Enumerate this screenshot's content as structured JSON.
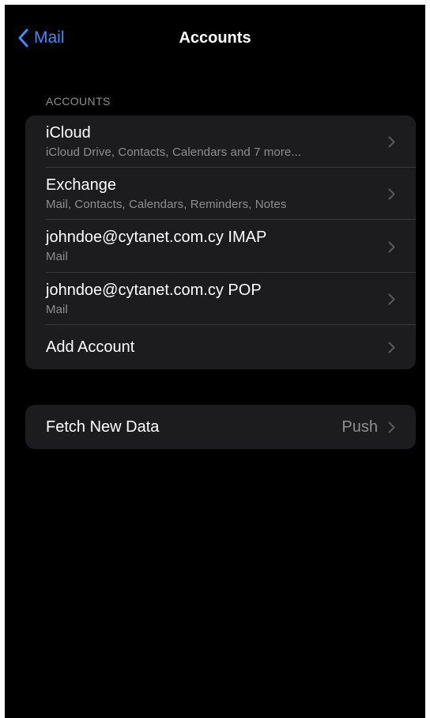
{
  "nav": {
    "back_label": "Mail",
    "title": "Accounts"
  },
  "accounts_section": {
    "header": "ACCOUNTS",
    "items": [
      {
        "title": "iCloud",
        "subtitle": "iCloud Drive, Contacts, Calendars and 7 more..."
      },
      {
        "title": "Exchange",
        "subtitle": "Mail, Contacts, Calendars, Reminders, Notes"
      },
      {
        "title": "johndoe@cytanet.com.cy IMAP",
        "subtitle": "Mail"
      },
      {
        "title": "johndoe@cytanet.com.cy POP",
        "subtitle": "Mail"
      }
    ],
    "add_account_label": "Add Account"
  },
  "fetch": {
    "label": "Fetch New Data",
    "value": "Push"
  },
  "colors": {
    "accent": "#3a8dff",
    "background": "#000000",
    "group_background": "#1c1c1e",
    "secondary_text": "#8e8e93",
    "separator": "#38383a"
  },
  "icons": [
    "chevron-left-icon",
    "chevron-right-icon"
  ]
}
